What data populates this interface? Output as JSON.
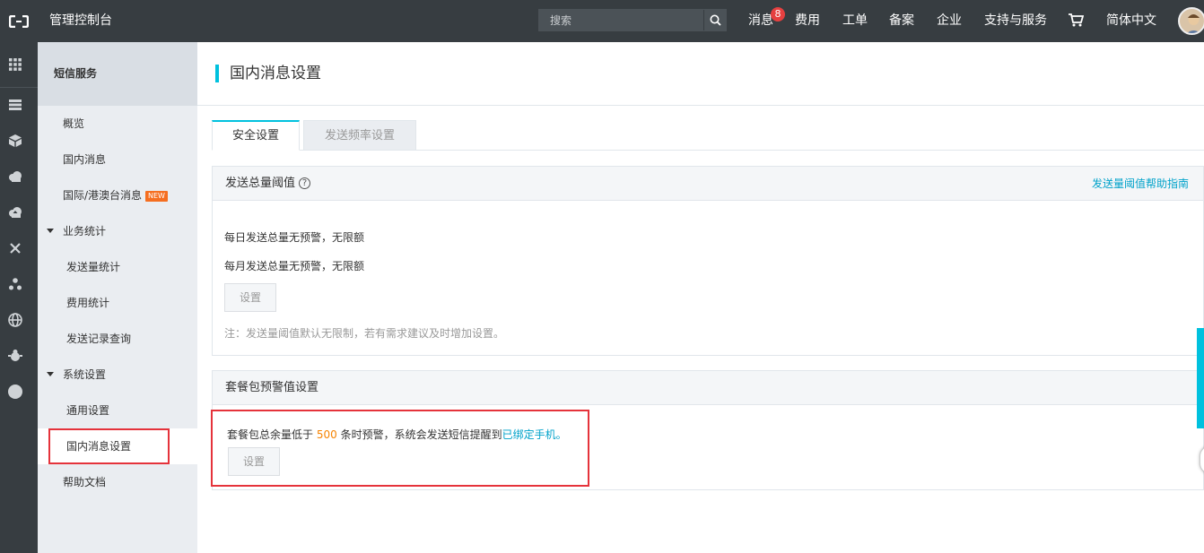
{
  "topbar": {
    "title": "管理控制台",
    "search_placeholder": "搜索",
    "nav": {
      "messages": "消息",
      "messages_badge": "8",
      "fees": "费用",
      "tickets": "工单",
      "icp": "备案",
      "enterprise": "企业",
      "support": "支持与服务",
      "language": "简体中文"
    }
  },
  "rail": {
    "icons": [
      "grid-icon",
      "server-icon",
      "cube-icon",
      "cloud-icon",
      "cloud-upload-icon",
      "network-icon",
      "share-icon",
      "globe-icon",
      "bug-icon",
      "circle-icon"
    ]
  },
  "sidebar": {
    "title": "短信服务",
    "items": {
      "overview": "概览",
      "domestic": "国内消息",
      "international": "国际/港澳台消息",
      "new_badge": "NEW",
      "stats_group": "业务统计",
      "send_stats": "发送量统计",
      "fee_stats": "费用统计",
      "send_records": "发送记录查询",
      "settings_group": "系统设置",
      "general_settings": "通用设置",
      "domestic_settings": "国内消息设置",
      "help_docs": "帮助文档"
    }
  },
  "page": {
    "title": "国内消息设置",
    "tabs": [
      "安全设置",
      "发送频率设置"
    ]
  },
  "threshold_panel": {
    "title": "发送总量阈值",
    "help_icon": "?",
    "help_link": "发送量阈值帮助指南",
    "daily": "每日发送总量无预警，无限额",
    "monthly": "每月发送总量无预警，无限额",
    "button": "设置",
    "note": "注：发送量阈值默认无限制，若有需求建议及时增加设置。"
  },
  "package_panel": {
    "title": "套餐包预警值设置",
    "text_before": "套餐包总余量低于",
    "count": "500",
    "text_after": "条时预警，系统会发送短信提醒到",
    "link": "已绑定手机",
    "period": "。",
    "button": "设置"
  },
  "colors": {
    "topbar": "#373d41",
    "accent": "#00c1de",
    "link": "#00a2ca",
    "highlight_box": "#e5333b",
    "number": "#f68300"
  }
}
